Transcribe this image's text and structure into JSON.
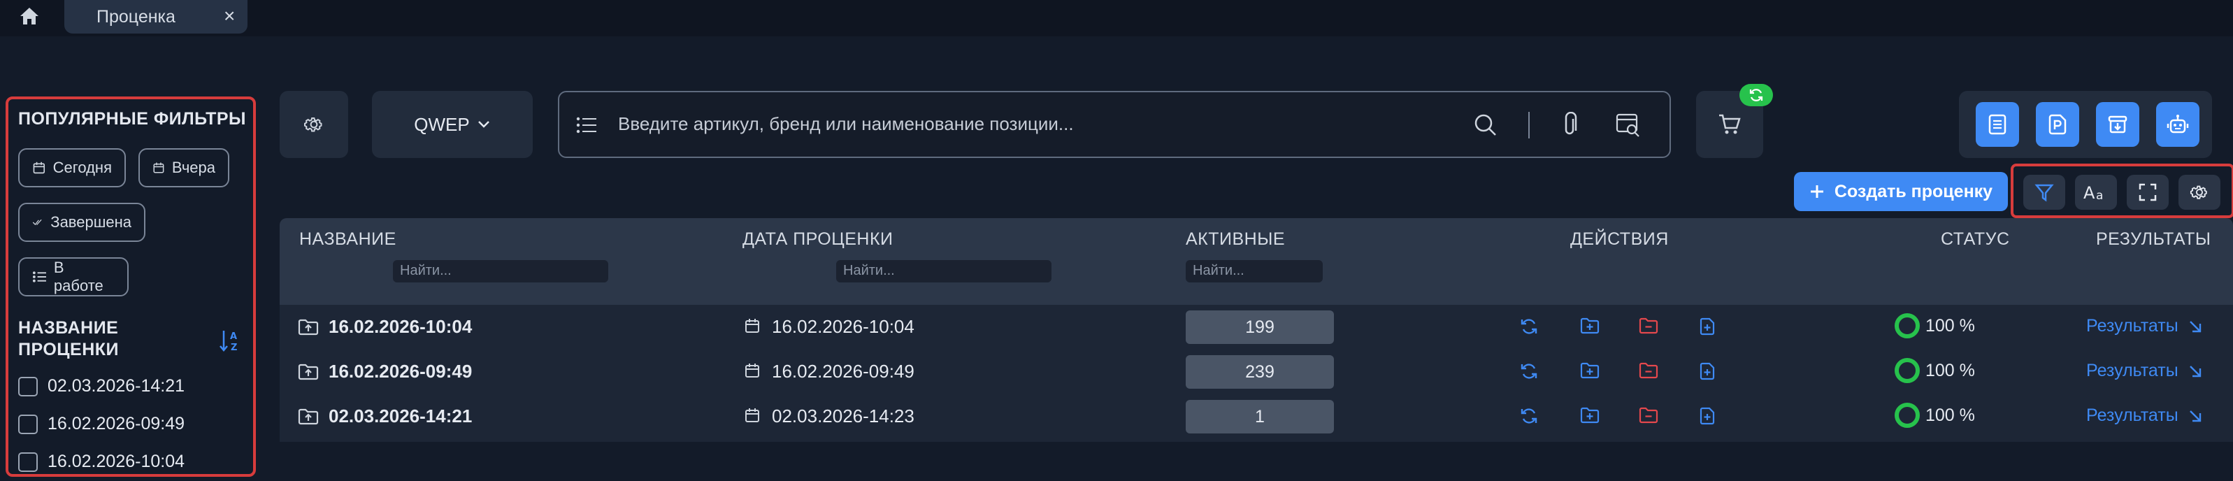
{
  "tab": {
    "title": "Проценка",
    "close": "×"
  },
  "sidebar": {
    "popular_title": "ПОПУЛЯРНЫЕ ФИЛЬТРЫ",
    "filters": [
      "Сегодня",
      "Вчера",
      "Завершена",
      "В работе"
    ],
    "name_title": "НАЗВАНИЕ ПРОЦЕНКИ",
    "items": [
      "02.03.2026-14:21",
      "16.02.2026-09:49",
      "16.02.2026-10:04"
    ]
  },
  "toolbar": {
    "source_label": "QWEP",
    "search_placeholder": "Введите артикул, бренд или наименование позиции...",
    "create_label": "Создать проценку"
  },
  "table": {
    "headers": {
      "name": "НАЗВАНИЕ",
      "date": "ДАТА ПРОЦЕНКИ",
      "active": "АКТИВНЫЕ",
      "actions": "ДЕЙСТВИЯ",
      "status": "СТАТУС",
      "results": "РЕЗУЛЬТАТЫ"
    },
    "filter_placeholder": "Найти...",
    "rows": [
      {
        "name": "16.02.2026-10:04",
        "date": "16.02.2026-10:04",
        "active": "199",
        "status": "100 %",
        "results": "Результаты"
      },
      {
        "name": "16.02.2026-09:49",
        "date": "16.02.2026-09:49",
        "active": "239",
        "status": "100 %",
        "results": "Результаты"
      },
      {
        "name": "02.03.2026-14:21",
        "date": "02.03.2026-14:23",
        "active": "1",
        "status": "100 %",
        "results": "Результаты"
      }
    ]
  },
  "colors": {
    "accent": "#3f8af4",
    "danger": "#e5484d",
    "success": "#27c24c",
    "highlight": "#d73c3c"
  }
}
